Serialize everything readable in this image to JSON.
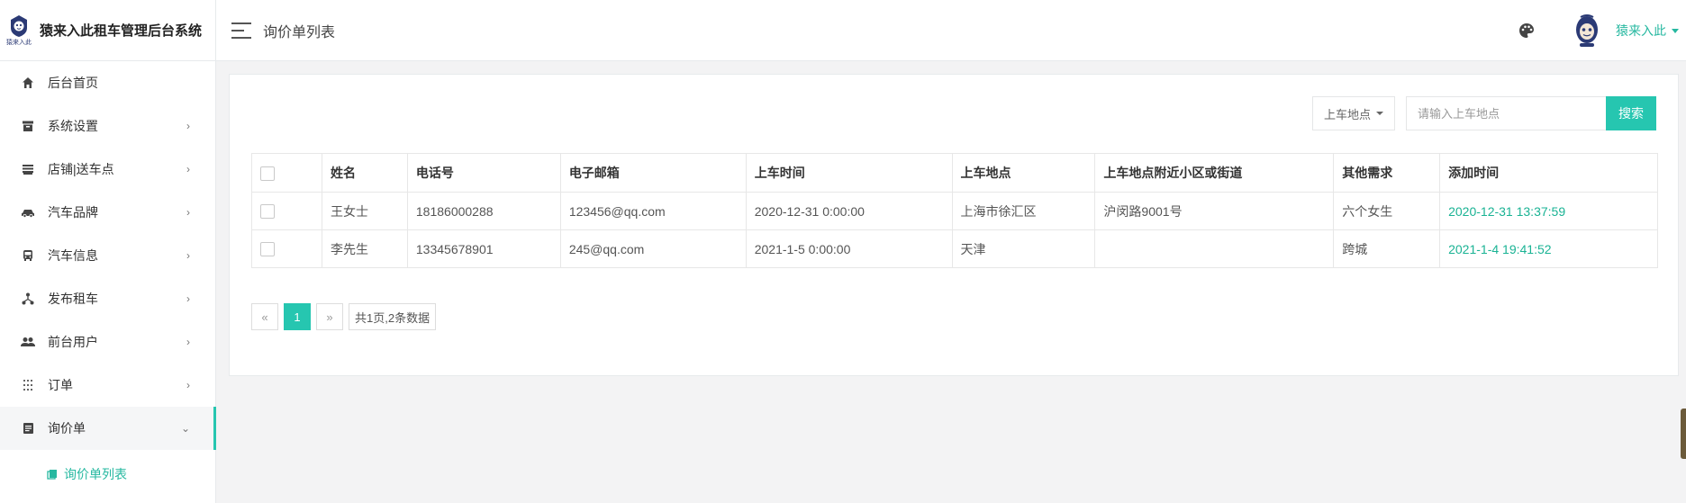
{
  "brand": {
    "logo_text": "猿来入此",
    "title": "猿来入此租车管理后台系统"
  },
  "sidebar": {
    "items": [
      {
        "label": "后台首页",
        "icon": "home-icon",
        "has_arrow": false
      },
      {
        "label": "系统设置",
        "icon": "archive-icon",
        "has_arrow": true
      },
      {
        "label": "店铺|送车点",
        "icon": "store-icon",
        "has_arrow": true
      },
      {
        "label": "汽车品牌",
        "icon": "car-icon",
        "has_arrow": true
      },
      {
        "label": "汽车信息",
        "icon": "bus-icon",
        "has_arrow": true
      },
      {
        "label": "发布租车",
        "icon": "network-icon",
        "has_arrow": true
      },
      {
        "label": "前台用户",
        "icon": "users-icon",
        "has_arrow": true
      },
      {
        "label": "订单",
        "icon": "grid-dots-icon",
        "has_arrow": true
      },
      {
        "label": "询价单",
        "icon": "document-icon",
        "has_arrow": true,
        "expanded": true
      }
    ],
    "arrow_right": "›",
    "arrow_down": "⌄",
    "submenu": {
      "label": "询价单列表",
      "icon": "book-icon"
    }
  },
  "header": {
    "title": "询价单列表",
    "user_name": "猿来入此"
  },
  "toolbar": {
    "dropdown_label": "上车地点",
    "search_placeholder": "请输入上车地点",
    "search_button": "搜索"
  },
  "table": {
    "columns": [
      "姓名",
      "电话号",
      "电子邮箱",
      "上车时间",
      "上车地点",
      "上车地点附近小区或街道",
      "其他需求",
      "添加时间"
    ],
    "rows": [
      [
        "王女士",
        "18186000288",
        "123456@qq.com",
        "2020-12-31 0:00:00",
        "上海市徐汇区",
        "沪闵路9001号",
        "六个女生",
        "2020-12-31 13:37:59"
      ],
      [
        "李先生",
        "13345678901",
        "245@qq.com",
        "2021-1-5 0:00:00",
        "天津",
        "",
        "跨城",
        "2021-1-4 19:41:52"
      ]
    ]
  },
  "pager": {
    "prev": "«",
    "current": "1",
    "next": "»",
    "info": "共1页,2条数据"
  },
  "colors": {
    "accent": "#26c6b0",
    "green_text": "#1ab394"
  }
}
